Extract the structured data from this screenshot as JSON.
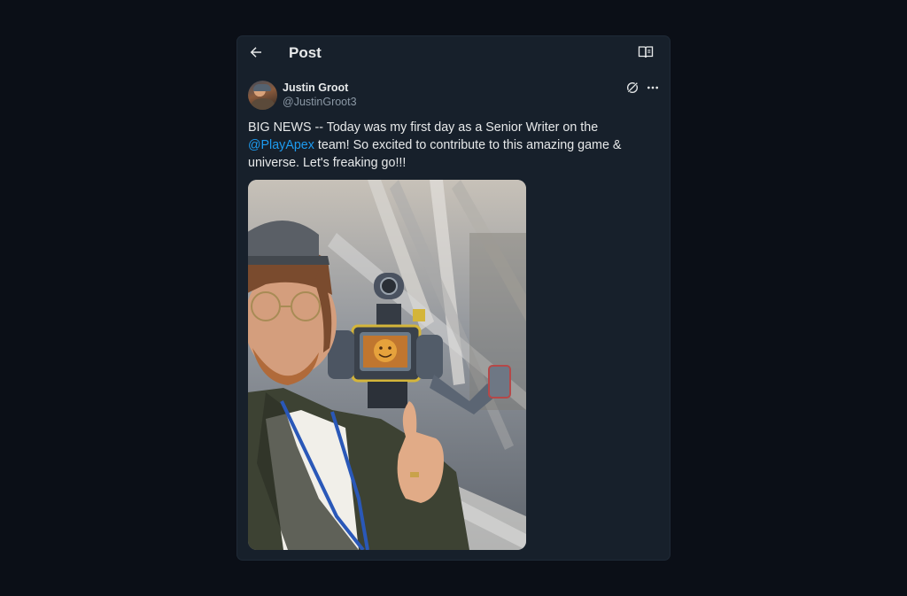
{
  "header": {
    "title": "Post",
    "back_icon": "arrow-left-icon",
    "reader_icon": "book-open-icon"
  },
  "post": {
    "author_name": "Justin Groot",
    "author_handle": "@JustinGroot3",
    "text_before": "BIG NEWS -- Today was my first day as a Senior Writer on the ",
    "mention": "@PlayApex",
    "text_after": " team! So excited to contribute to this amazing game & universe. Let's freaking go!!!",
    "grok_icon": "grok-icon",
    "more_icon": "more-dots-icon",
    "media": {
      "type": "photo",
      "alt": ""
    }
  },
  "colors": {
    "page_bg": "#0b0f17",
    "card_bg": "#17202b",
    "text": "#e7e9ea",
    "muted": "#8b98a5",
    "accent": "#1d9bf0"
  }
}
